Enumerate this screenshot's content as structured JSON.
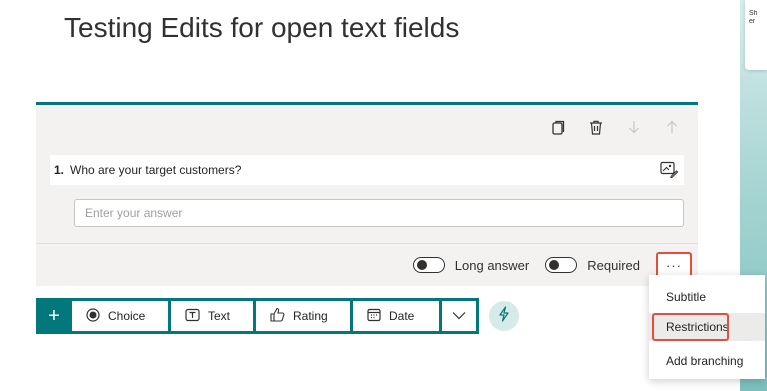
{
  "form": {
    "title": "Testing Edits for open text fields"
  },
  "question": {
    "number": "1.",
    "text": "Who are your target customers?",
    "answer_placeholder": "Enter your answer",
    "long_answer_label": "Long answer",
    "required_label": "Required",
    "more_label": "···"
  },
  "toolbar_icons": [
    "copy-icon",
    "delete-icon",
    "move-down-icon",
    "move-up-icon"
  ],
  "add_bar": {
    "plus": "+",
    "types": [
      {
        "label": "Choice",
        "icon": "radio-icon"
      },
      {
        "label": "Text",
        "icon": "text-box-icon"
      },
      {
        "label": "Rating",
        "icon": "thumb-up-icon"
      },
      {
        "label": "Date",
        "icon": "calendar-icon"
      }
    ]
  },
  "menu": {
    "items": [
      "Subtitle",
      "Restrictions",
      "Add branching"
    ]
  },
  "side_panel": {
    "text": "Sh\ner"
  },
  "colors": {
    "accent": "#03787c",
    "highlight": "#e74c3c"
  }
}
